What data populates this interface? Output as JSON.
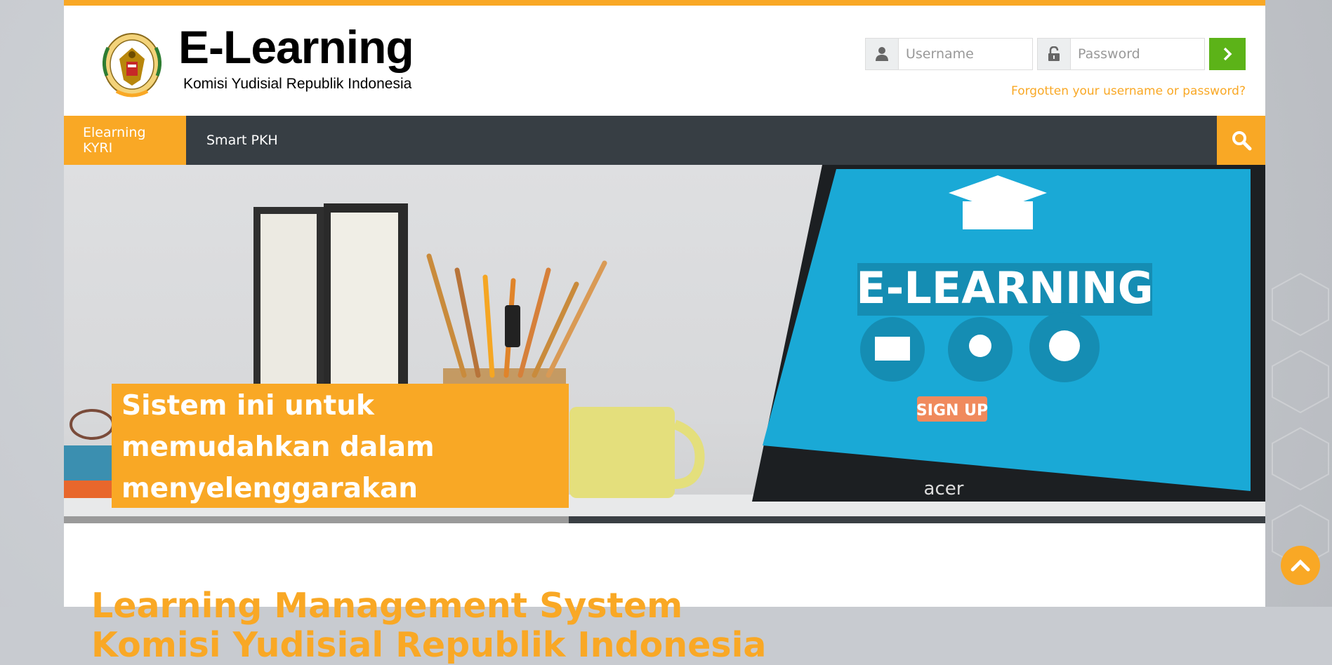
{
  "brand": {
    "title": "E-Learning",
    "subtitle": "Komisi Yudisial Republik Indonesia",
    "seal_text": "KOMISI YUDISIAL REPUBLIK INDONESIA"
  },
  "login": {
    "username_placeholder": "Username",
    "password_placeholder": "Password",
    "submit_icon": "chevron-right-icon",
    "forgot_link": "Forgotten your username or password?"
  },
  "nav": {
    "items": [
      {
        "label": "Elearning KYRI",
        "active": true
      },
      {
        "label": "Smart PKH",
        "active": false
      }
    ],
    "search_icon": "search-icon"
  },
  "hero": {
    "caption": "Sistem ini untuk memudahkan dalam menyelenggarakan pelatihan",
    "screen_title": "E-LEARNING",
    "screen_button": "SIGN UP",
    "laptop_brand": "acer",
    "slide_progress": 0.42
  },
  "content": {
    "title_line1": "Learning Management System",
    "title_line2": "Komisi Yudisial Republik Indonesia"
  },
  "colors": {
    "accent": "#f9a825",
    "nav_bg": "#373e44",
    "submit_green": "#5cb318"
  }
}
